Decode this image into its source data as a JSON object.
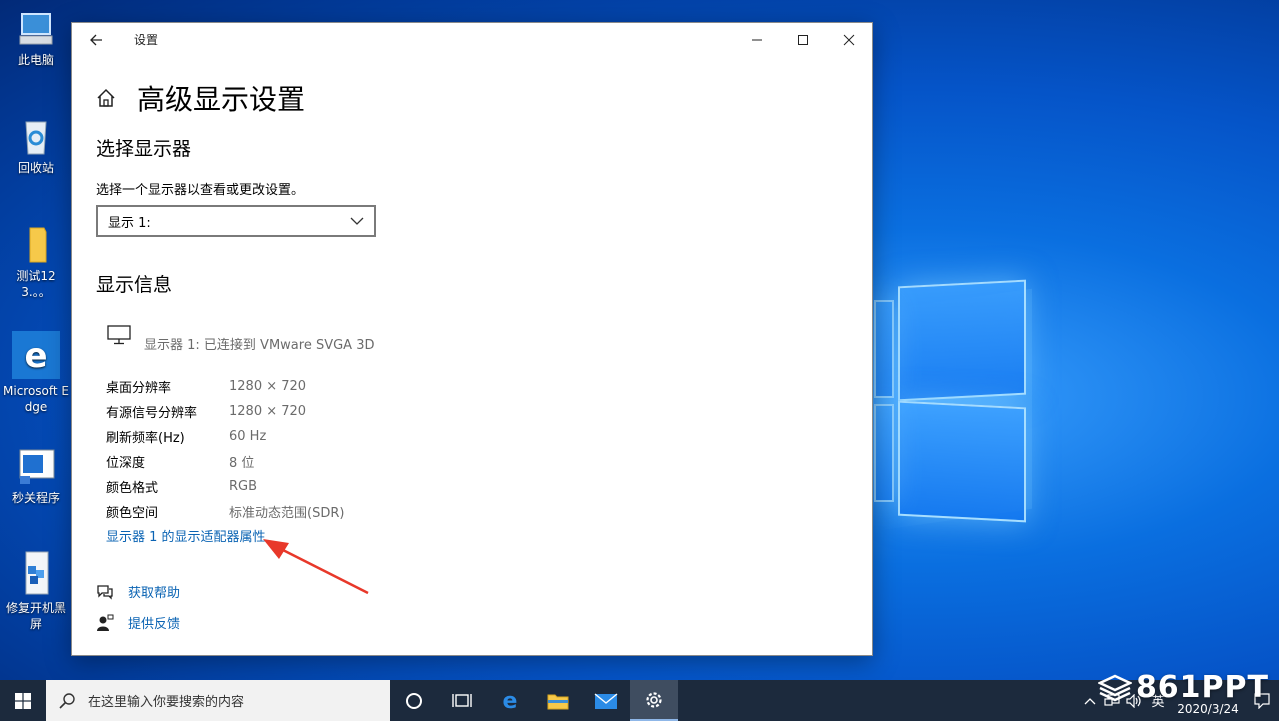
{
  "desktop": {
    "icons": [
      {
        "label": "此电脑"
      },
      {
        "label": "回收站"
      },
      {
        "label": "测试123.。。"
      },
      {
        "label": "Microsoft Edge"
      },
      {
        "label": "秒关程序"
      },
      {
        "label": "修复开机黑屏"
      }
    ]
  },
  "window": {
    "title": "设置",
    "page_title": "高级显示设置",
    "select_section": {
      "heading": "选择显示器",
      "description": "选择一个显示器以查看或更改设置。",
      "dropdown_value": "显示 1:"
    },
    "info_section": {
      "heading": "显示信息",
      "monitor_label": "显示器 1: 已连接到 VMware SVGA 3D",
      "rows": [
        {
          "key": "桌面分辨率",
          "value": "1280 × 720"
        },
        {
          "key": "有源信号分辨率",
          "value": "1280 × 720"
        },
        {
          "key": "刷新频率(Hz)",
          "value": "60 Hz"
        },
        {
          "key": "位深度",
          "value": "8 位"
        },
        {
          "key": "颜色格式",
          "value": "RGB"
        },
        {
          "key": "颜色空间",
          "value": "标准动态范围(SDR)"
        }
      ],
      "adapter_link": "显示器 1 的显示适配器属性"
    },
    "help": {
      "get_help": "获取帮助",
      "feedback": "提供反馈"
    }
  },
  "taskbar": {
    "search_placeholder": "在这里输入你要搜索的内容",
    "ime": "英",
    "date": "2020/3/24"
  },
  "watermark": "861PPT",
  "colors": {
    "link": "#0a63b3",
    "taskbar": "#1c2a3d",
    "annotation_arrow": "#e8382a"
  }
}
